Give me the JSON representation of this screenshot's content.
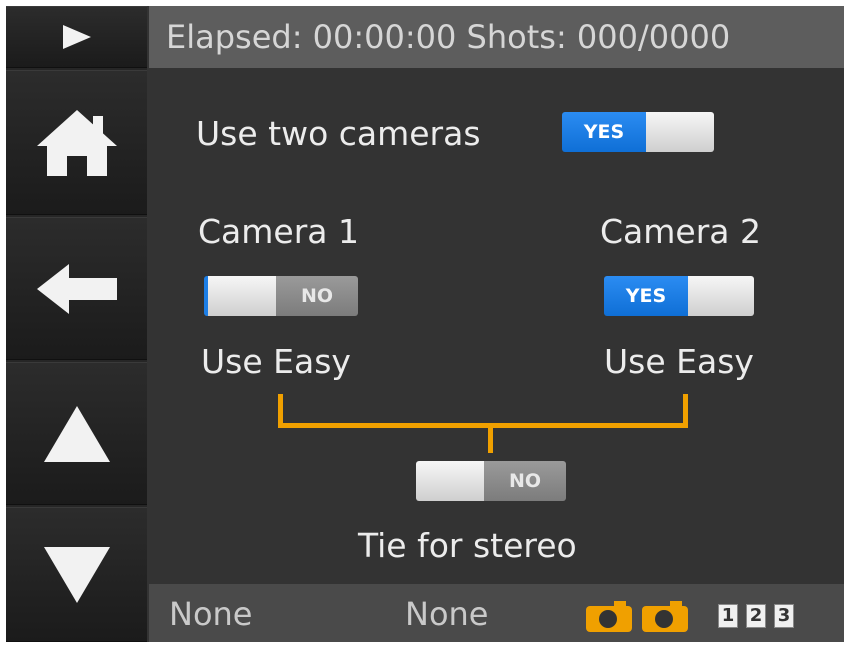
{
  "header": {
    "status_text": "Elapsed: 00:00:00 Shots: 000/0000"
  },
  "sidebar": {
    "items": [
      {
        "name": "play",
        "icon": "play-icon"
      },
      {
        "name": "home",
        "icon": "home-icon"
      },
      {
        "name": "back",
        "icon": "arrow-left-icon"
      },
      {
        "name": "up",
        "icon": "triangle-up-icon"
      },
      {
        "name": "down",
        "icon": "triangle-down-icon"
      }
    ]
  },
  "main": {
    "use_two_cameras": {
      "label": "Use two cameras",
      "toggle": "YES"
    },
    "camera1": {
      "title": "Camera 1",
      "toggle": "NO",
      "label": "Use Easy"
    },
    "camera2": {
      "title": "Camera 2",
      "toggle": "YES",
      "label": "Use Easy"
    },
    "tie": {
      "toggle": "NO",
      "label": "Tie for stereo"
    }
  },
  "footer": {
    "left_value": "None",
    "mid_value": "None",
    "numbers": [
      "1",
      "2",
      "3"
    ]
  },
  "colors": {
    "accent": "#f0a000",
    "toggle_on": "#1c7ee6",
    "header_bg": "#5d5d5d"
  }
}
